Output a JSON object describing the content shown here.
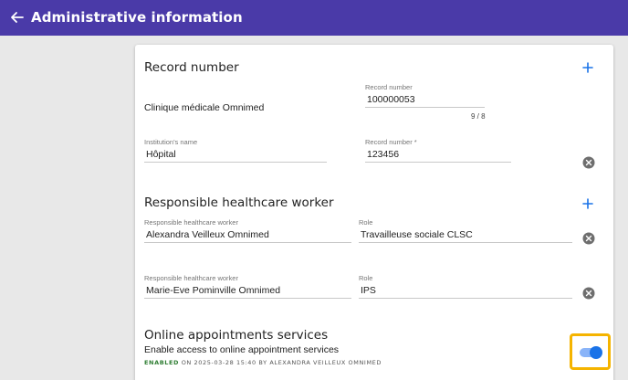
{
  "header": {
    "title": "Administrative information"
  },
  "record_section": {
    "title": "Record number",
    "clinic_name": "Clinique médicale Omnimed",
    "record_field": {
      "label": "Record number",
      "value": "100000053",
      "counter": "9 / 8"
    },
    "institution_field": {
      "label": "Institution's name",
      "value": "Hôpital"
    },
    "record_field_2": {
      "label": "Record number *",
      "value": "123456"
    }
  },
  "healthcare_section": {
    "title": "Responsible healthcare worker",
    "rows": [
      {
        "worker_label": "Responsible healthcare worker",
        "worker_value": "Alexandra Veilleux Omnimed",
        "role_label": "Role",
        "role_value": "Travailleuse sociale CLSC"
      },
      {
        "worker_label": "Responsible healthcare worker",
        "worker_value": "Marie-Eve Pominville Omnimed",
        "role_label": "Role",
        "role_value": "IPS"
      }
    ]
  },
  "online_section": {
    "title": "Online appointments services",
    "description": "Enable access to online appointment services",
    "status_tag": "ENABLED",
    "status_detail": " ON 2025-03-28 15:40 BY ALEXANDRA VEILLEUX OMNIMED",
    "toggle_on": true
  },
  "icons": {
    "back": "arrow-left-icon",
    "add": "plus-icon",
    "clear": "close-circle-icon"
  },
  "colors": {
    "appbar": "#4a3aa8",
    "accent": "#1a73e8",
    "focus_ring": "#f5b400",
    "enabled": "#2e7d32"
  }
}
